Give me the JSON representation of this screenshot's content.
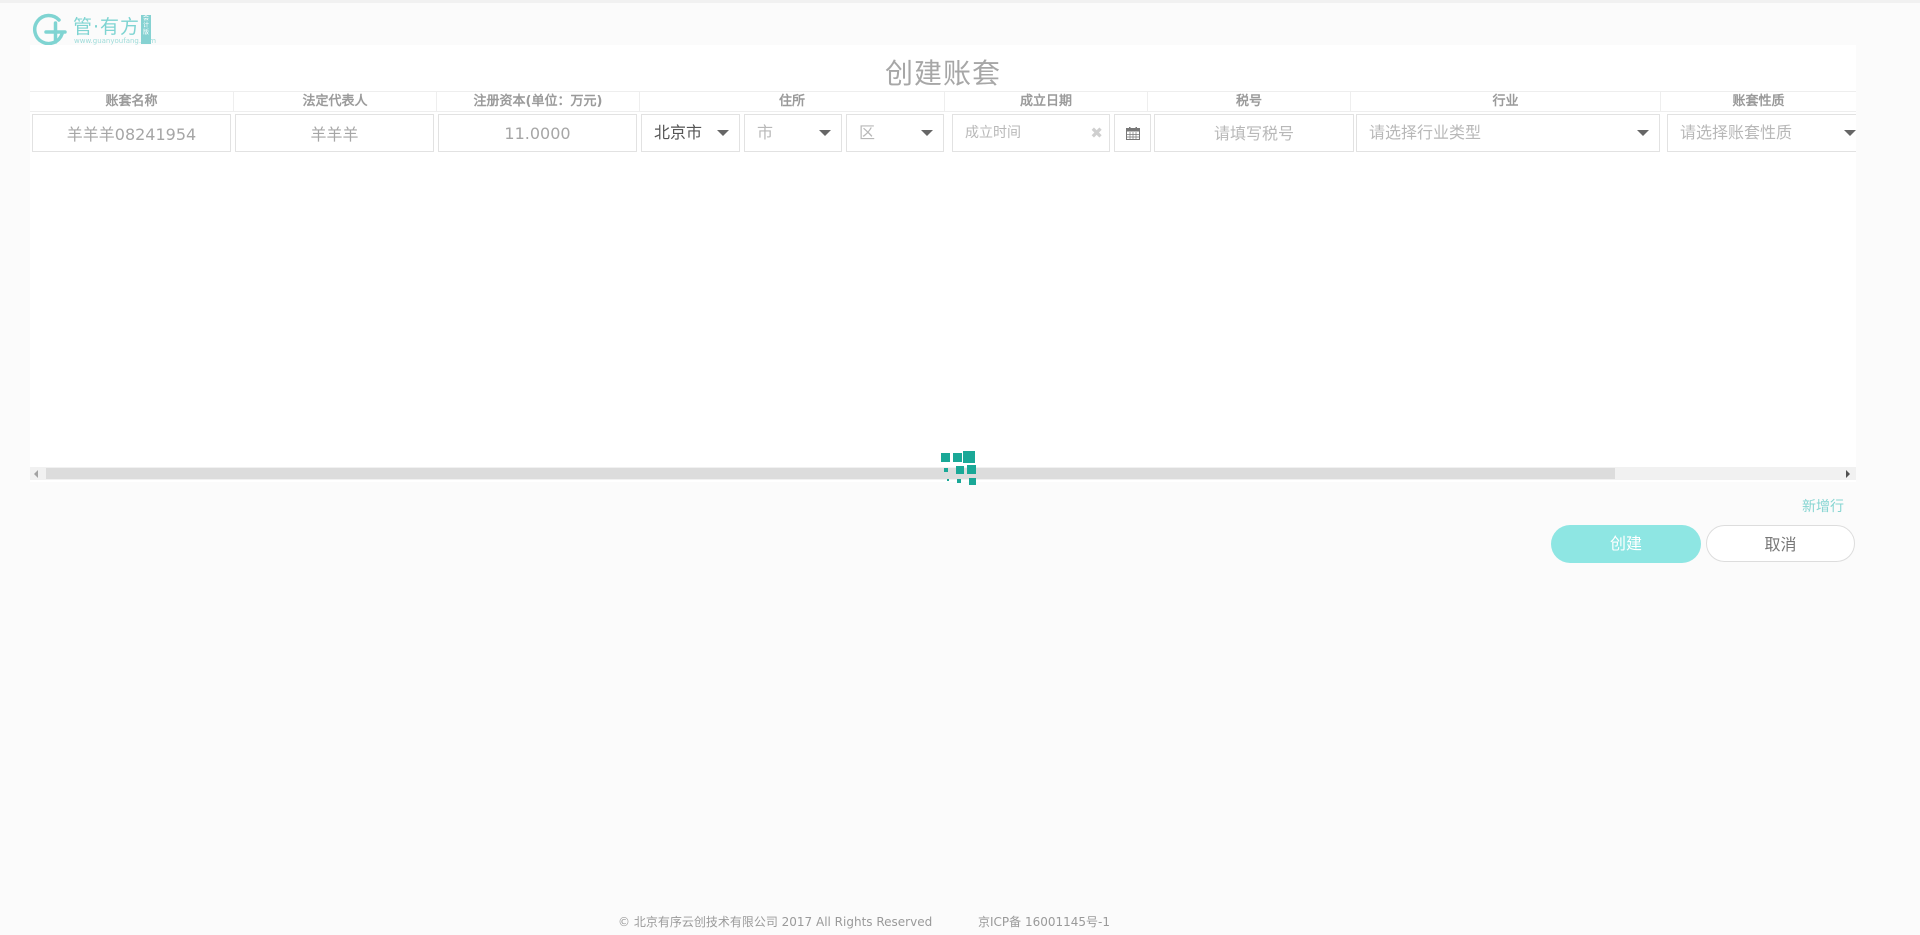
{
  "brand": {
    "name": "管·有方",
    "url": "www.guanyoufang.com",
    "badge": "会计版",
    "accent": "#86d2d2"
  },
  "page": {
    "title": "创建账套"
  },
  "table": {
    "headers": {
      "name": "账套名称",
      "legal_rep": "法定代表人",
      "capital": "注册资本(单位：万元)",
      "address": "住所",
      "established": "成立日期",
      "tax_no": "税号",
      "industry": "行业",
      "nature": "账套性质"
    },
    "row": {
      "name": "羊羊羊08241954",
      "legal_rep": "羊羊羊",
      "capital": "11.0000",
      "province": "北京市",
      "city": "市",
      "district": "区",
      "date_placeholder": "成立时间",
      "tax_placeholder": "请填写税号",
      "industry_placeholder": "请选择行业类型",
      "nature_placeholder": "请选择账套性质"
    }
  },
  "actions": {
    "add_row": "新增行",
    "create": "创建",
    "cancel": "取消",
    "primary_color": "#8ee6e3"
  },
  "footer": {
    "copyright": "© 北京有序云创技术有限公司 2017 All Rights Reserved",
    "icp": "京ICP备 16001145号-1"
  },
  "icons": {
    "calendar": "calendar-icon",
    "clear": "clear-icon",
    "caret": "chevron-down-icon",
    "loading": "loading-spinner-icon"
  }
}
